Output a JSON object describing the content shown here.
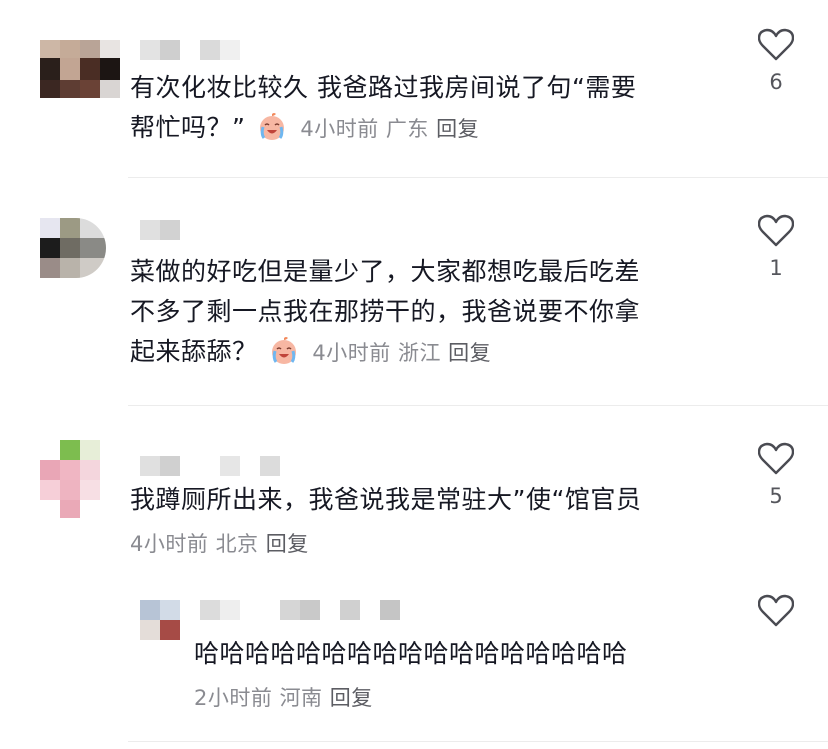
{
  "comments": [
    {
      "text_line1": "有次化妆比较久 我爸路过我房间说了句“需要",
      "text_line2": "帮忙吗？”",
      "time": "4小时前",
      "location": "广东",
      "reply_label": "回复",
      "likes": "6",
      "emoji": "crying-laugh-emoji"
    },
    {
      "text_line1": "菜做的好吃但是量少了，大家都想吃最后吃差",
      "text_line2": "不多了剩一点我在那捞干的，我爸说要不你拿",
      "text_line3": "起来舔舔？",
      "time": "4小时前",
      "location": "浙江",
      "reply_label": "回复",
      "likes": "1",
      "emoji": "crying-laugh-emoji"
    },
    {
      "text_line1": "我蹲厕所出来，我爸说我是常驻大”使“馆官员",
      "time": "4小时前",
      "location": "北京",
      "reply_label": "回复",
      "likes": "5"
    }
  ],
  "reply": {
    "text": "哈哈哈哈哈哈哈哈哈哈哈哈哈哈哈哈哈",
    "time": "2小时前",
    "location": "河南",
    "reply_label": "回复",
    "likes": ""
  },
  "colors": {
    "text": "#161823",
    "meta": "#8a8b91",
    "divider": "#ececec",
    "heart_stroke": "#4a4b52"
  }
}
